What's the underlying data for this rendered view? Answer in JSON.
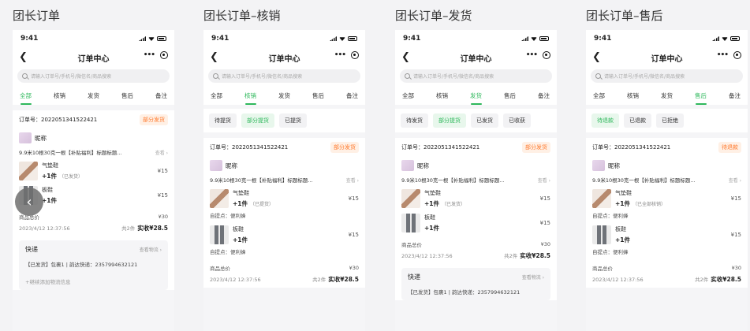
{
  "columns": [
    {
      "title": "团长订单",
      "time": "9:41",
      "nav_title": "订单中心",
      "search_placeholder": "请输入订单号/手机号/微信名/商品搜索",
      "tabs": [
        "全部",
        "核销",
        "发货",
        "售后",
        "备注"
      ],
      "active_tab": 0,
      "chips": [],
      "order_no": "订单号：2022051341522421",
      "badge": "部分发货",
      "nickname": "昵称",
      "item_title": "9.9米10根30克一根【补贴福利】标题标题...",
      "view": "查看 ›",
      "products": [
        {
          "name": "气垫鞋",
          "qty": "+1件",
          "status": "（已发货）",
          "price": "¥15",
          "pickup": ""
        },
        {
          "name": "板鞋",
          "qty": "+1件",
          "status": "",
          "price": "¥15",
          "pickup": ""
        }
      ],
      "total_label": "商品总价",
      "total_value": "¥30",
      "order_time": "2023/4/12 12:37:56",
      "paid_count": "共2件",
      "paid": "实收¥28.5",
      "ship_label": "快递",
      "ship_link": "查看物流 ›",
      "ship_info": "【已发货】包裹1 | 韵达快递：2357994632121",
      "ship_add": "+继续添加物流信息"
    },
    {
      "title": "团长订单–核销",
      "time": "9:41",
      "nav_title": "订单中心",
      "search_placeholder": "请输入订单号/手机号/微信名/商品搜索",
      "tabs": [
        "全部",
        "核销",
        "发货",
        "售后",
        "备注"
      ],
      "active_tab": 1,
      "chips": [
        "待提货",
        "部分提货",
        "已提货"
      ],
      "active_chip": 1,
      "order_no": "订单号：2022051341522421",
      "badge": "部分发货",
      "nickname": "昵称",
      "item_title": "9.9米10根30克一根【补贴福利】标题标题...",
      "view": "查看 ›",
      "products": [
        {
          "name": "气垫鞋",
          "qty": "+1件",
          "status": "（已提货）",
          "price": "¥15",
          "pickup": "自提点：便利蜂"
        },
        {
          "name": "板鞋",
          "qty": "+1件",
          "status": "",
          "price": "¥15",
          "pickup": "自提点：便利蜂"
        }
      ],
      "total_label": "商品总价",
      "total_value": "¥30",
      "order_time": "2023/4/12 12:37:56",
      "paid_count": "共2件",
      "paid": "实收¥28.5"
    },
    {
      "title": "团长订单–发货",
      "time": "9:41",
      "nav_title": "订单中心",
      "search_placeholder": "请输入订单号/手机号/微信名/商品搜索",
      "tabs": [
        "全部",
        "核销",
        "发货",
        "售后",
        "备注"
      ],
      "active_tab": 2,
      "chips": [
        "待发货",
        "部分提货",
        "已发货",
        "已收获"
      ],
      "active_chip": 1,
      "order_no": "订单号：2022051341522421",
      "badge": "部分发货",
      "nickname": "昵称",
      "item_title": "9.9米10根30克一根【补贴福利】标题标题...",
      "view": "查看 ›",
      "products": [
        {
          "name": "气垫鞋",
          "qty": "+1件",
          "status": "（已发货）",
          "price": "¥15",
          "pickup": ""
        },
        {
          "name": "板鞋",
          "qty": "+1件",
          "status": "",
          "price": "¥15",
          "pickup": ""
        }
      ],
      "total_label": "商品总价",
      "total_value": "¥30",
      "order_time": "2023/4/12 12:37:56",
      "paid_count": "共2件",
      "paid": "实收¥28.5",
      "ship_label": "快递",
      "ship_link": "查看物流 ›",
      "ship_info": "【已发货】包裹1 | 韵达快递：2357994632121",
      "ship_add": ""
    },
    {
      "title": "团长订单–售后",
      "time": "9:41",
      "nav_title": "订单中心",
      "search_placeholder": "请输入订单号/手机号/微信名/商品搜索",
      "tabs": [
        "全部",
        "核销",
        "发货",
        "售后",
        "备注"
      ],
      "active_tab": 3,
      "chips": [
        "待退款",
        "已退款",
        "已拒绝"
      ],
      "active_chip": 0,
      "order_no": "订单号：2022051341522421",
      "badge": "待退款",
      "nickname": "昵称",
      "item_title": "9.9米10根30克一根【补贴福利】标题标题...",
      "view": "查看 ›",
      "products": [
        {
          "name": "气垫鞋",
          "qty": "+1件",
          "status": "（已全部核销）",
          "price": "¥15",
          "pickup": "自提点：便利蜂"
        },
        {
          "name": "板鞋",
          "qty": "+1件",
          "status": "",
          "price": "¥15",
          "pickup": "自提点：便利蜂"
        }
      ],
      "total_label": "商品总价",
      "total_value": "¥30",
      "order_time": "2023/4/12 12:37:56",
      "paid_count": "共2件",
      "paid": "实收¥28.5"
    }
  ],
  "slider_arrow": "‹",
  "colors": {
    "accent": "#2fb85c",
    "badge": "#ff7a2e"
  }
}
